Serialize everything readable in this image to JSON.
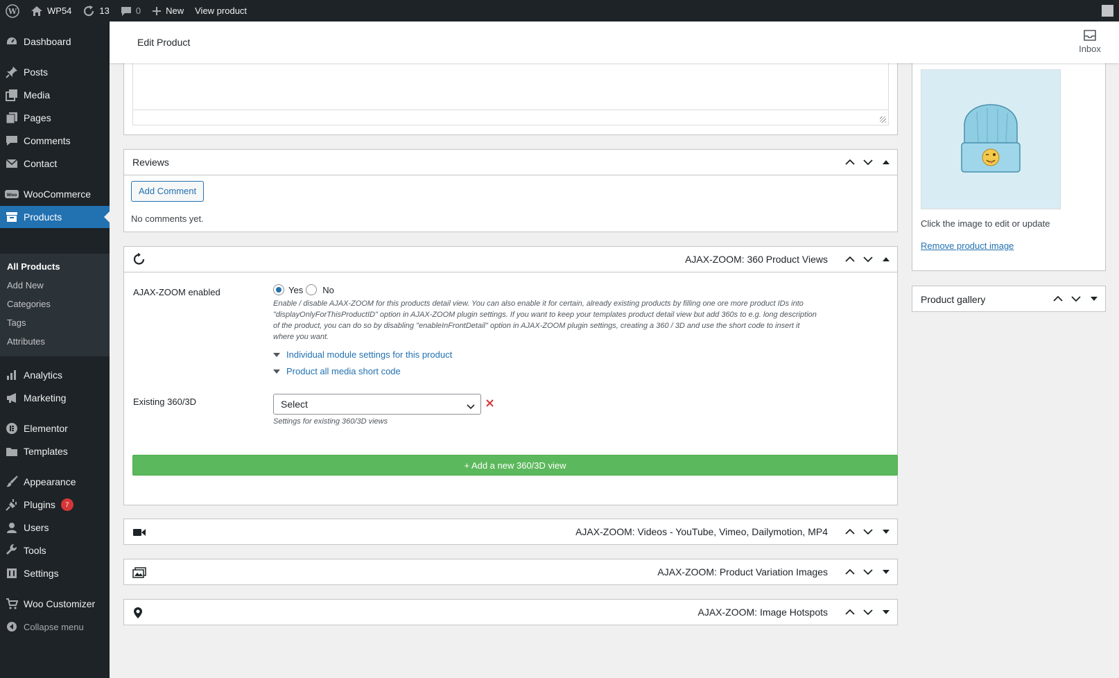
{
  "adminbar": {
    "site_name": "WP54",
    "updates_count": "13",
    "comments_count": "0",
    "new_label": "New",
    "view_label": "View product"
  },
  "sidebar": {
    "items": [
      {
        "label": "Dashboard",
        "icon": "dashboard-icon"
      },
      {
        "label": "Posts",
        "icon": "pin-icon"
      },
      {
        "label": "Media",
        "icon": "media-icon"
      },
      {
        "label": "Pages",
        "icon": "pages-icon"
      },
      {
        "label": "Comments",
        "icon": "comment-icon"
      },
      {
        "label": "Contact",
        "icon": "mail-icon"
      },
      {
        "label": "WooCommerce",
        "icon": "woo-icon"
      },
      {
        "label": "Products",
        "icon": "archive-icon"
      },
      {
        "label": "Analytics",
        "icon": "chart-icon"
      },
      {
        "label": "Marketing",
        "icon": "megaphone-icon"
      },
      {
        "label": "Elementor",
        "icon": "elementor-icon"
      },
      {
        "label": "Templates",
        "icon": "folder-icon"
      },
      {
        "label": "Appearance",
        "icon": "brush-icon"
      },
      {
        "label": "Plugins",
        "icon": "plug-icon"
      },
      {
        "label": "Users",
        "icon": "user-icon"
      },
      {
        "label": "Tools",
        "icon": "wrench-icon"
      },
      {
        "label": "Settings",
        "icon": "settings-icon"
      },
      {
        "label": "Woo Customizer",
        "icon": "cart-icon"
      },
      {
        "label": "Collapse menu",
        "icon": "collapse-icon"
      }
    ],
    "plugins_badge": "7",
    "submenu": [
      "All Products",
      "Add New",
      "Categories",
      "Tags",
      "Attributes"
    ]
  },
  "header": {
    "title": "Edit Product",
    "inbox_label": "Inbox"
  },
  "reviews": {
    "title": "Reviews",
    "add_comment": "Add Comment",
    "empty_text": "No comments yet."
  },
  "az360": {
    "title": "AJAX-ZOOM: 360 Product Views",
    "enabled_label": "AJAX-ZOOM enabled",
    "yes_label": "Yes",
    "no_label": "No",
    "description_lines": [
      "Enable / disable AJAX-ZOOM for this products detail view. You can also enable it for certain, already existing products by filling one ore more product IDs into",
      "\"displayOnlyForThisProductID\" option in AJAX-ZOOM plugin settings. If you want to keep your templates product detail view but add 360s to e.g. long description",
      "of the product, you can do so by disabling \"enableInFrontDetail\" option in AJAX-ZOOM plugin settings, creating a 360 / 3D and use the short code to insert it",
      "where you want."
    ],
    "module_settings_link": "Individual module settings for this product",
    "short_code_link": "Product all media short code",
    "existing_label": "Existing 360/3D",
    "select_value": "Select",
    "existing_note": "Settings for existing 360/3D views",
    "add_button": "+ Add a new 360/3D view"
  },
  "videos": {
    "title": "AJAX-ZOOM: Videos - YouTube, Vimeo, Dailymotion, MP4"
  },
  "variation": {
    "title": "AJAX-ZOOM: Product Variation Images"
  },
  "hotspots": {
    "title": "AJAX-ZOOM: Image Hotspots"
  },
  "product_image": {
    "hint": "Click the image to edit or update",
    "remove_link": "Remove product image"
  },
  "gallery": {
    "title": "Product gallery"
  },
  "colors": {
    "admin_dark": "#1d2327",
    "accent_blue": "#2271b1",
    "add_green": "#5cb85c",
    "badge_red": "#d63638"
  }
}
